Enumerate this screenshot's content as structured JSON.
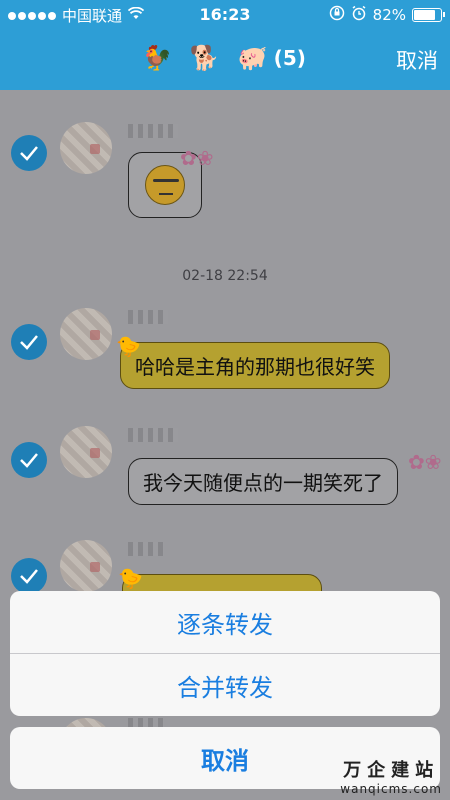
{
  "status_bar": {
    "carrier": "中国联通",
    "time": "16:23",
    "battery": "82%",
    "battery_level": 0.82,
    "icons": [
      "signal-dots-icon",
      "wifi-icon",
      "orientation-lock-icon",
      "alarm-icon",
      "battery-icon"
    ]
  },
  "nav": {
    "icons": [
      "rooster-icon",
      "dog-icon",
      "pig-icon"
    ],
    "count": "(5)",
    "cancel": "取消"
  },
  "chat": {
    "timestamp": "02-18 22:54",
    "messages": [
      {
        "type": "sticker",
        "selected": true,
        "sticker_icon": "face-emoji-icon"
      },
      {
        "type": "text",
        "selected": true,
        "text": "哈哈是主角的那期也很好笑",
        "bubble_color": "#f4d12b"
      },
      {
        "type": "text",
        "selected": true,
        "text": "我今天随便点的一期笑死了",
        "bubble_color": "#ffffff"
      },
      {
        "type": "text",
        "selected": true,
        "text": "",
        "bubble_color": "#f4d12b"
      }
    ]
  },
  "action_sheet": {
    "items": [
      "逐条转发",
      "合并转发"
    ],
    "cancel": "取消"
  },
  "watermark": {
    "cn": "万企建站",
    "en": "wanqicms.com"
  },
  "colors": {
    "header_bg": "#2d9ed6",
    "accent": "#1a7ee0",
    "check_bg": "#1f7fb6"
  }
}
